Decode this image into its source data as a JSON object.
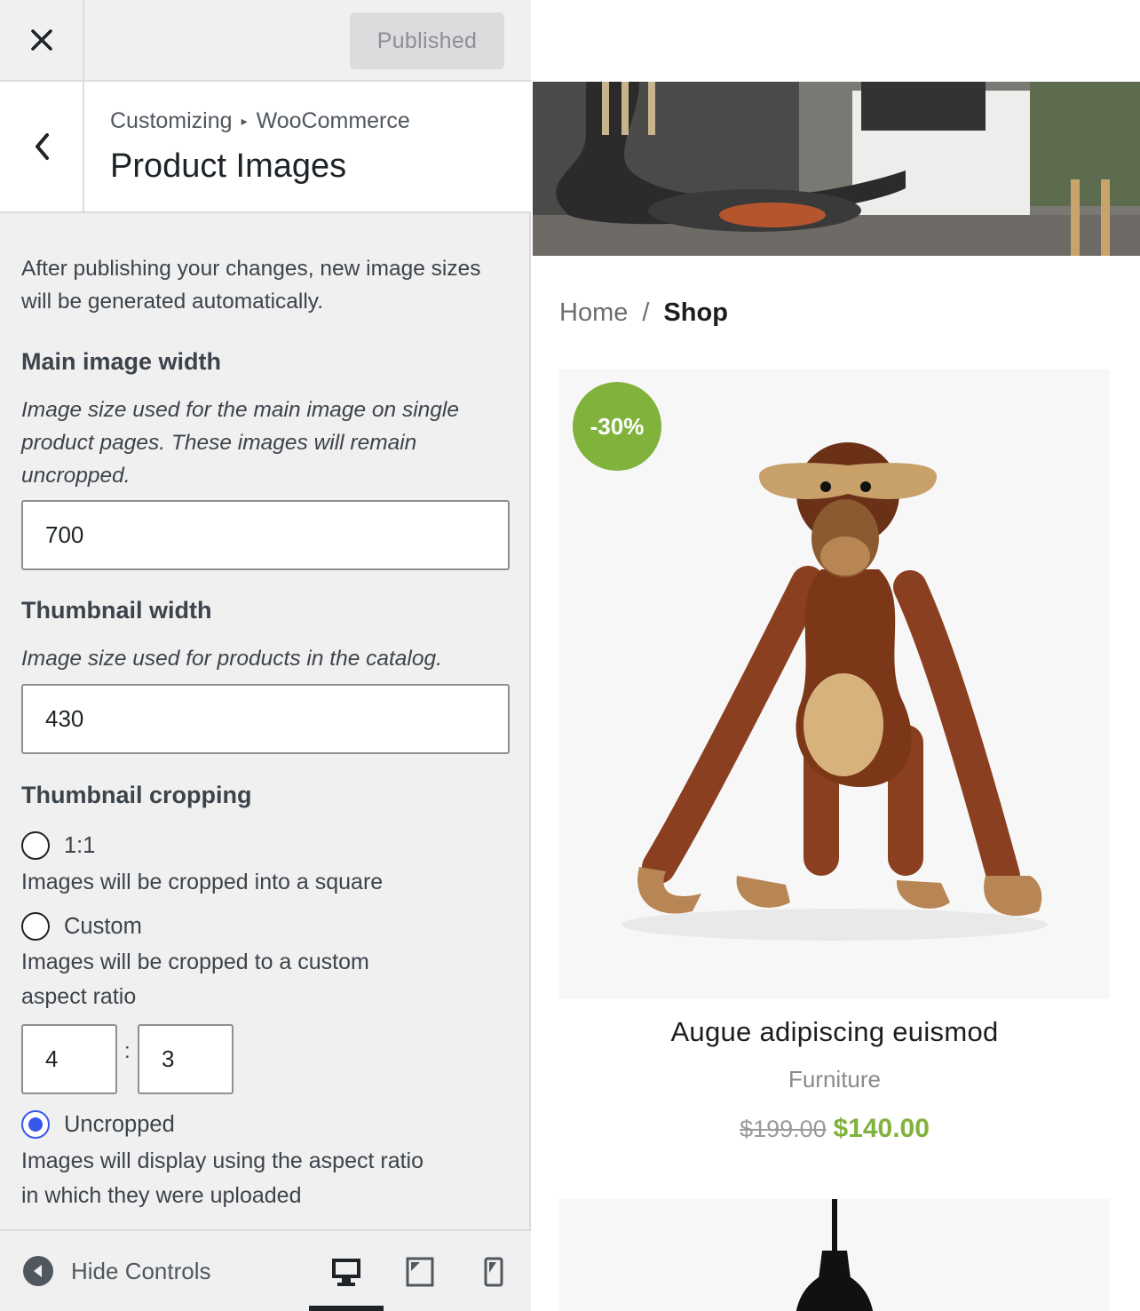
{
  "topbar": {
    "published_label": "Published"
  },
  "section": {
    "breadcrumb_root": "Customizing",
    "breadcrumb_sep": "▸",
    "breadcrumb_parent": "WooCommerce",
    "title": "Product Images"
  },
  "panel": {
    "notice": "After publishing your changes, new image sizes will be generated automatically.",
    "main_width": {
      "title": "Main image width",
      "description": "Image size used for the main image on single product pages. These images will remain uncropped.",
      "value": "700"
    },
    "thumb_width": {
      "title": "Thumbnail width",
      "description": "Image size used for products in the catalog.",
      "value": "430"
    },
    "cropping": {
      "title": "Thumbnail cropping",
      "options": [
        {
          "label": "1:1",
          "description": "Images will be cropped into a square",
          "checked": false
        },
        {
          "label": "Custom",
          "description": "Images will be cropped to a custom aspect ratio",
          "checked": false
        },
        {
          "label": "Uncropped",
          "description": "Images will display using the aspect ratio in which they were uploaded",
          "checked": true
        }
      ],
      "ratio_width": "4",
      "ratio_sep": ":",
      "ratio_height": "3"
    }
  },
  "footer": {
    "hide_controls_label": "Hide Controls",
    "active_device": "desktop"
  },
  "preview": {
    "breadcrumb_home": "Home",
    "breadcrumb_sep": "/",
    "breadcrumb_current": "Shop",
    "product": {
      "badge": "-30%",
      "name": "Augue adipiscing euismod",
      "category": "Furniture",
      "old_price": "$199.00",
      "price": "$140.00"
    }
  },
  "colors": {
    "accent_radio": "#3858e9",
    "sale_green": "#81b23c",
    "sidebar_bg": "#f0f0f1"
  }
}
